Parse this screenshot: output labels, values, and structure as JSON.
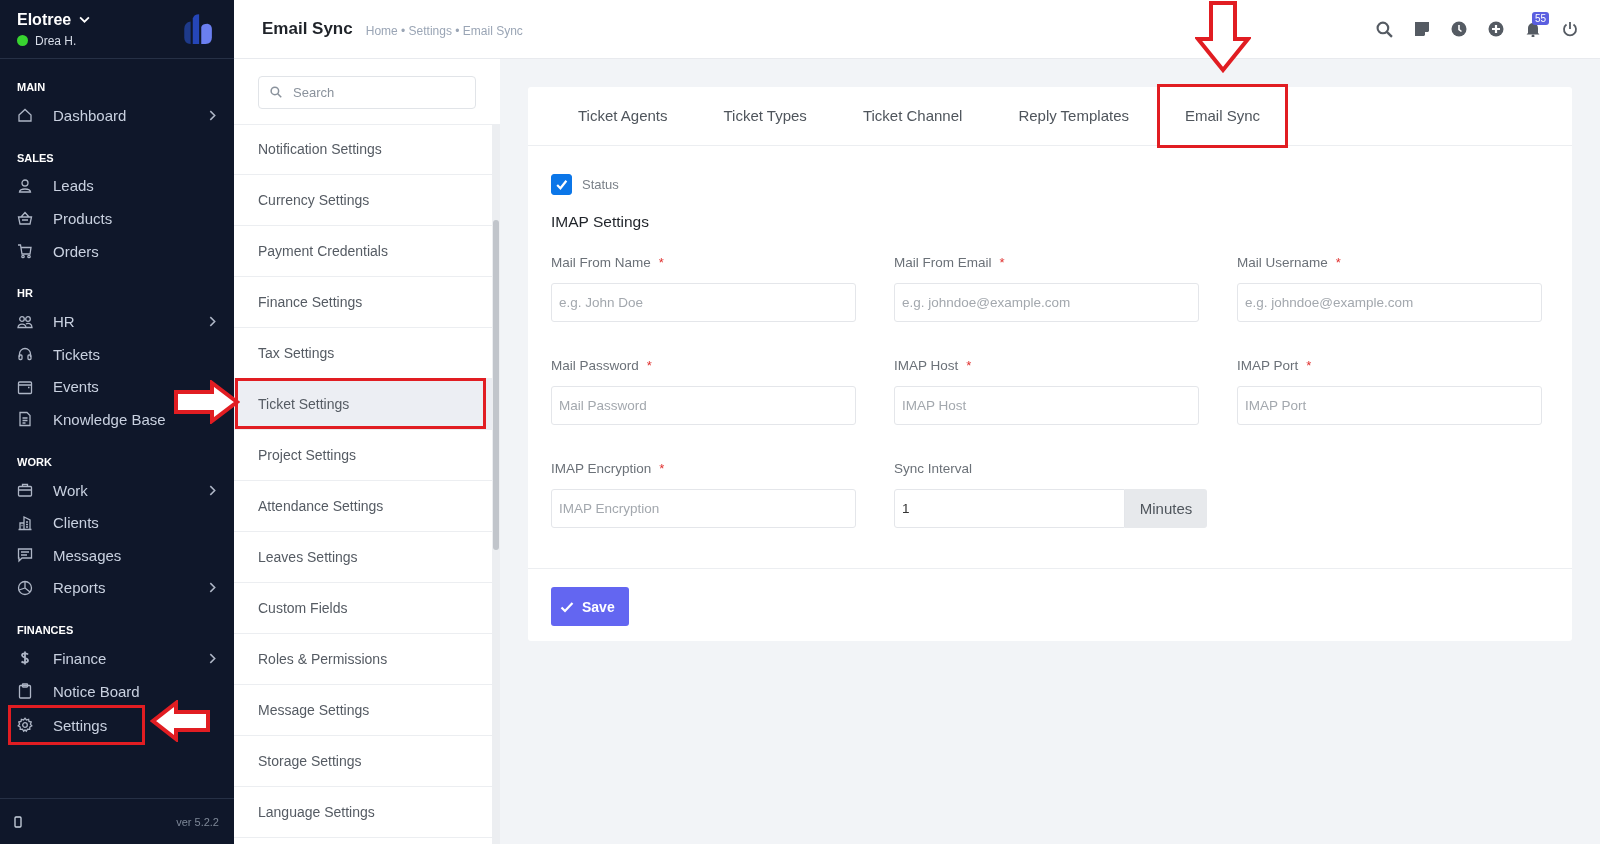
{
  "sidebar": {
    "company": "Elotree",
    "user": {
      "name": "Drea H.",
      "online": true
    },
    "sections": [
      {
        "heading": "MAIN",
        "items": [
          {
            "label": "Dashboard",
            "kind": "home",
            "has_submenu": true,
            "marked": false
          }
        ]
      },
      {
        "heading": "SALES",
        "items": [
          {
            "label": "Leads",
            "kind": "person",
            "has_submenu": false,
            "marked": false
          },
          {
            "label": "Products",
            "kind": "basket",
            "has_submenu": false,
            "marked": false
          },
          {
            "label": "Orders",
            "kind": "cart",
            "has_submenu": false,
            "marked": false
          }
        ]
      },
      {
        "heading": "HR",
        "items": [
          {
            "label": "HR",
            "kind": "people",
            "has_submenu": true,
            "marked": false
          },
          {
            "label": "Tickets",
            "kind": "headset",
            "has_submenu": false,
            "marked": false
          },
          {
            "label": "Events",
            "kind": "calendar",
            "has_submenu": false,
            "marked": false
          },
          {
            "label": "Knowledge Base",
            "kind": "document",
            "has_submenu": false,
            "marked": false
          }
        ]
      },
      {
        "heading": "WORK",
        "items": [
          {
            "label": "Work",
            "kind": "briefcase",
            "has_submenu": true,
            "marked": false
          },
          {
            "label": "Clients",
            "kind": "building",
            "has_submenu": false,
            "marked": false
          },
          {
            "label": "Messages",
            "kind": "message",
            "has_submenu": false,
            "marked": false
          },
          {
            "label": "Reports",
            "kind": "pie",
            "has_submenu": true,
            "marked": false
          }
        ]
      },
      {
        "heading": "FINANCES",
        "items": [
          {
            "label": "Finance",
            "kind": "dollar",
            "has_submenu": true,
            "marked": false
          },
          {
            "label": "Notice Board",
            "kind": "clipboard",
            "has_submenu": false,
            "marked": false
          },
          {
            "label": "Settings",
            "kind": "gear",
            "has_submenu": false,
            "marked": true
          }
        ]
      }
    ],
    "version": "ver 5.2.2"
  },
  "header": {
    "title": "Email Sync",
    "breadcrumb": "Home • Settings • Email Sync",
    "notification_count": "55"
  },
  "settings_menu": {
    "search": {
      "placeholder": "Search"
    },
    "items": [
      {
        "label": "Notification Settings",
        "selected": false,
        "marked": false
      },
      {
        "label": "Currency Settings",
        "selected": false,
        "marked": false
      },
      {
        "label": "Payment Credentials",
        "selected": false,
        "marked": false
      },
      {
        "label": "Finance Settings",
        "selected": false,
        "marked": false
      },
      {
        "label": "Tax Settings",
        "selected": false,
        "marked": false
      },
      {
        "label": "Ticket Settings",
        "selected": true,
        "marked": true
      },
      {
        "label": "Project Settings",
        "selected": false,
        "marked": false
      },
      {
        "label": "Attendance Settings",
        "selected": false,
        "marked": false
      },
      {
        "label": "Leaves Settings",
        "selected": false,
        "marked": false
      },
      {
        "label": "Custom Fields",
        "selected": false,
        "marked": false
      },
      {
        "label": "Roles & Permissions",
        "selected": false,
        "marked": false
      },
      {
        "label": "Message Settings",
        "selected": false,
        "marked": false
      },
      {
        "label": "Storage Settings",
        "selected": false,
        "marked": false
      },
      {
        "label": "Language Settings",
        "selected": false,
        "marked": false
      }
    ]
  },
  "tabs": [
    {
      "label": "Ticket Agents",
      "marked": false
    },
    {
      "label": "Ticket Types",
      "marked": false
    },
    {
      "label": "Ticket Channel",
      "marked": false
    },
    {
      "label": "Reply Templates",
      "marked": false
    },
    {
      "label": "Email Sync",
      "marked": true
    }
  ],
  "form": {
    "status": {
      "label": "Status",
      "checked": true
    },
    "section_title": "IMAP Settings",
    "fields": [
      {
        "label": "Mail From Name",
        "required_mark": "*",
        "placeholder": "e.g. John Doe"
      },
      {
        "label": "Mail From Email",
        "required_mark": "*",
        "placeholder": "e.g. johndoe@example.com"
      },
      {
        "label": "Mail Username",
        "required_mark": "*",
        "placeholder": "e.g. johndoe@example.com"
      },
      {
        "label": "Mail Password",
        "required_mark": "*",
        "placeholder": "Mail Password"
      },
      {
        "label": "IMAP Host",
        "required_mark": "*",
        "placeholder": "IMAP Host"
      },
      {
        "label": "IMAP Port",
        "required_mark": "*",
        "placeholder": "IMAP Port"
      },
      {
        "label": "IMAP Encryption",
        "required_mark": "*",
        "placeholder": "IMAP Encryption"
      }
    ],
    "sync_interval": {
      "label": "Sync Interval",
      "value": "1",
      "unit": "Minutes"
    },
    "save_button": "Save"
  }
}
